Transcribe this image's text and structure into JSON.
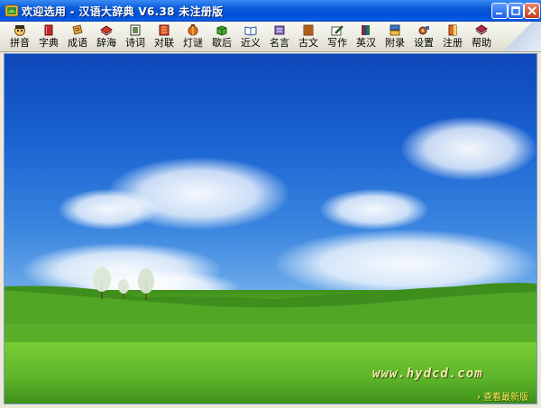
{
  "window": {
    "title": "欢迎选用 - 汉语大辞典 V6.38 未注册版"
  },
  "toolbar": {
    "items": [
      {
        "label": "拼音",
        "icon": "pinyin-face-icon",
        "color": "#d9a33a"
      },
      {
        "label": "字典",
        "icon": "red-book-icon",
        "color": "#c0282a"
      },
      {
        "label": "成语",
        "icon": "scroll-icon",
        "color": "#d08a2a"
      },
      {
        "label": "辞海",
        "icon": "red-books-icon",
        "color": "#c53a2a"
      },
      {
        "label": "诗词",
        "icon": "framed-picture-icon",
        "color": "#5a7a3a"
      },
      {
        "label": "对联",
        "icon": "couplet-icon",
        "color": "#c03a20"
      },
      {
        "label": "灯谜",
        "icon": "lantern-icon",
        "color": "#d07020"
      },
      {
        "label": "歇后",
        "icon": "green-cube-icon",
        "color": "#3a9a3a"
      },
      {
        "label": "近义",
        "icon": "open-book-icon",
        "color": "#2a5aa8"
      },
      {
        "label": "名言",
        "icon": "quote-book-icon",
        "color": "#6a4aa0"
      },
      {
        "label": "古文",
        "icon": "old-book-icon",
        "color": "#c06020"
      },
      {
        "label": "写作",
        "icon": "notepad-pen-icon",
        "color": "#4a8a4a"
      },
      {
        "label": "英汉",
        "icon": "dictionary-books-icon",
        "color": "#8a2a2a"
      },
      {
        "label": "附录",
        "icon": "appendix-icon",
        "color": "#3a6ab0"
      },
      {
        "label": "设置",
        "icon": "settings-icon",
        "color": "#b04a2a"
      },
      {
        "label": "注册",
        "icon": "register-book-icon",
        "color": "#d05a20"
      },
      {
        "label": "帮助",
        "icon": "help-book-icon",
        "color": "#a02040"
      }
    ]
  },
  "content": {
    "watermark": "www.hydcd.com",
    "update_link": "查看最新版"
  }
}
